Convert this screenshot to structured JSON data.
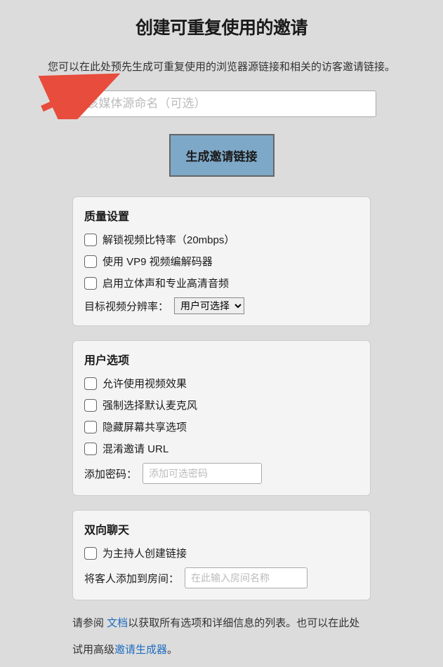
{
  "title": "创建可重复使用的邀请",
  "subtitle": "您可以在此处预先生成可重复使用的浏览器源链接和相关的访客邀请链接。",
  "name_input": {
    "placeholder": "为该媒体源命名（可选）"
  },
  "generate_button": "生成邀请链接",
  "quality": {
    "title": "质量设置",
    "unlock_bitrate": "解锁视频比特率（20mbps）",
    "vp9_codec": "使用 VP9 视频编解码器",
    "stereo_audio": "启用立体声和专业高清音频",
    "resolution_label": "目标视频分辨率：",
    "resolution_selected": "用户可选择"
  },
  "user_options": {
    "title": "用户选项",
    "allow_effects": "允许使用视频效果",
    "force_mic": "强制选择默认麦克风",
    "hide_screen_share": "隐藏屏幕共享选项",
    "obfuscate_url": "混淆邀请 URL",
    "password_label": "添加密码：",
    "password_placeholder": "添加可选密码"
  },
  "chat": {
    "title": "双向聊天",
    "host_link": "为主持人创建链接",
    "room_label": "将客人添加到房间：",
    "room_placeholder": "在此输入房间名称"
  },
  "footer": {
    "part1": "请参阅 ",
    "docs_link": "文档",
    "part2": "以获取所有选项和详细信息的列表。也可以在此处",
    "part3": "试用高级",
    "generator_link": "邀请生成器",
    "part4": "。"
  }
}
